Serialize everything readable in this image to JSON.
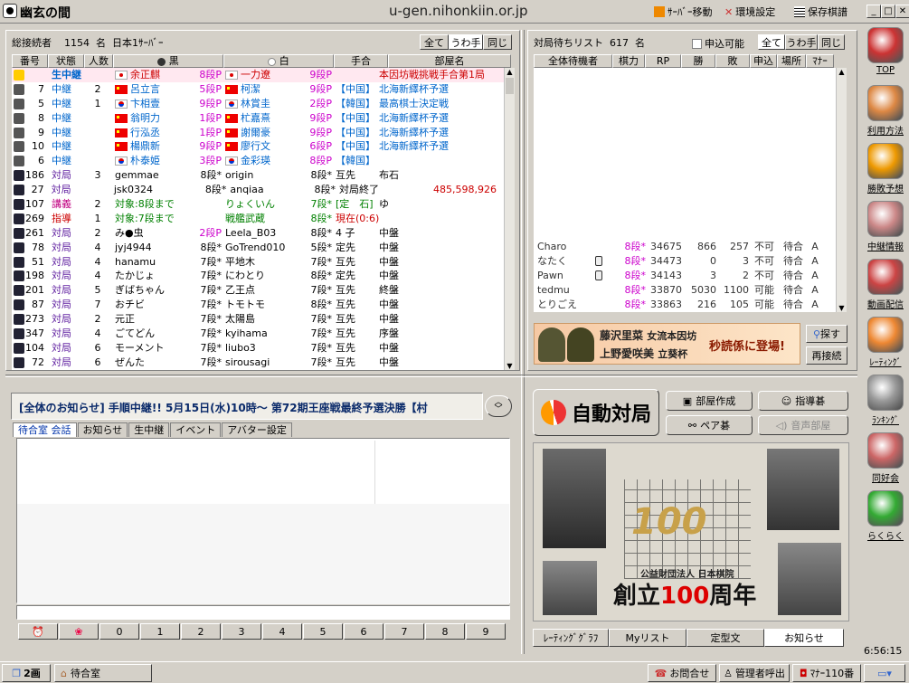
{
  "app": {
    "title": "幽玄の間",
    "url": "u-gen.nihonkiin.or.jp"
  },
  "toolbar": {
    "server_move": "ｻｰﾊﾞｰ移動",
    "env_settings": "環境設定",
    "saved_games": "保存棋譜"
  },
  "left": {
    "connected_label": "総接続者",
    "connected_count": "1154",
    "connected_unit": "名",
    "server": "日本1ｻｰﾊﾞｰ",
    "filters": [
      "全て",
      "うわ手",
      "同じ"
    ],
    "columns": [
      "番号",
      "状態",
      "人数",
      "黒",
      "白",
      "手合",
      "部屋名"
    ],
    "rows": [
      {
        "no": "",
        "status": "生中継",
        "n": "",
        "bf": "jp",
        "black": "余正麒",
        "brank": "8段P",
        "wf": "jp",
        "white": "一力遼",
        "wrank": "9段P",
        "teai": "",
        "room": "本因坊戦挑戦手合第1局"
      },
      {
        "no": "7",
        "status": "中継",
        "n": "2",
        "bf": "cn",
        "black": "呂立言",
        "brank": "5段P",
        "wf": "cn",
        "white": "柯潔",
        "wrank": "9段P",
        "teai": "【中国】",
        "room": "北海新繹杯予選"
      },
      {
        "no": "5",
        "status": "中継",
        "n": "1",
        "bf": "kr",
        "black": "卞相壹",
        "brank": "9段P",
        "wf": "kr",
        "white": "林賞圭",
        "wrank": "2段P",
        "teai": "【韓国】",
        "room": "最高棋士決定戦"
      },
      {
        "no": "8",
        "status": "中継",
        "n": "",
        "bf": "cn",
        "black": "翁明力",
        "brank": "1段P",
        "wf": "cn",
        "white": "杧嘉熹",
        "wrank": "9段P",
        "teai": "【中国】",
        "room": "北海新繹杯予選"
      },
      {
        "no": "9",
        "status": "中継",
        "n": "",
        "bf": "cn",
        "black": "行泓丞",
        "brank": "1段P",
        "wf": "cn",
        "white": "謝爾豪",
        "wrank": "9段P",
        "teai": "【中国】",
        "room": "北海新繹杯予選"
      },
      {
        "no": "10",
        "status": "中継",
        "n": "",
        "bf": "cn",
        "black": "楊鼎新",
        "brank": "9段P",
        "wf": "cn",
        "white": "廖行文",
        "wrank": "6段P",
        "teai": "【中国】",
        "room": "北海新繹杯予選"
      },
      {
        "no": "6",
        "status": "中継",
        "n": "",
        "bf": "kr",
        "black": "朴泰姫",
        "brank": "3段P",
        "wf": "kr",
        "white": "金彩瑛",
        "wrank": "8段P",
        "teai": "【韓国】",
        "room": ""
      },
      {
        "no": "186",
        "status": "対局",
        "n": "3",
        "bf": "",
        "black": "gemmae",
        "brank": "8段*",
        "wf": "",
        "white": "origin",
        "wrank": "8段*",
        "teai": "互先",
        "room": "布石"
      },
      {
        "no": "27",
        "status": "対局",
        "n": "",
        "bf": "",
        "black": "jsk0324",
        "bf2": "kr",
        "brank": "8段*",
        "wf": "",
        "white": "anqiaa",
        "wf2": "cn",
        "wrank": "8段*",
        "teai": "対局終了",
        "room": "485,598,926"
      },
      {
        "no": "107",
        "status": "講義",
        "n": "2",
        "bf": "",
        "black": "対象:8段まで",
        "brank": "",
        "wf": "",
        "white": "りょくいん",
        "wrank": "7段*",
        "teai": "[定　石]",
        "room": "ゆ"
      },
      {
        "no": "269",
        "status": "指導",
        "n": "1",
        "bf": "",
        "black": "対象:7段まで",
        "brank": "",
        "wf": "",
        "white": "戦艦武蔵",
        "wrank": "8段*",
        "teai": "現在(0:6)",
        "room": ""
      },
      {
        "no": "261",
        "status": "対局",
        "n": "2",
        "bf": "",
        "black": "み●虫",
        "brank": "2段P",
        "wf": "",
        "white": "Leela_B03",
        "wrank": "8段*",
        "teai": "4 子",
        "room": "中盤"
      },
      {
        "no": "78",
        "status": "対局",
        "n": "4",
        "bf": "",
        "black": "jyj4944",
        "brank": "8段*",
        "wf": "",
        "white": "GoTrend010",
        "wrank": "5段*",
        "teai": "定先",
        "room": "中盤"
      },
      {
        "no": "51",
        "status": "対局",
        "n": "4",
        "bf": "",
        "black": "hanamu",
        "brank": "7段*",
        "wf": "",
        "white": "平地木",
        "wrank": "7段*",
        "teai": "互先",
        "room": "中盤"
      },
      {
        "no": "198",
        "status": "対局",
        "n": "4",
        "bf": "",
        "black": "たかじょ",
        "brank": "7段*",
        "wf": "",
        "white": "にわとり",
        "wrank": "8段*",
        "teai": "定先",
        "room": "中盤"
      },
      {
        "no": "201",
        "status": "対局",
        "n": "5",
        "bf": "",
        "black": "ぎばちゃん",
        "brank": "7段*",
        "wf": "",
        "white": "乙王点",
        "wrank": "7段*",
        "teai": "互先",
        "room": "終盤"
      },
      {
        "no": "87",
        "status": "対局",
        "n": "7",
        "bf": "",
        "black": "おチビ",
        "brank": "7段*",
        "wf": "",
        "white": "トモトモ",
        "wrank": "8段*",
        "teai": "互先",
        "room": "中盤"
      },
      {
        "no": "273",
        "status": "対局",
        "n": "2",
        "bf": "",
        "black": "元正",
        "brank": "7段*",
        "wf": "",
        "white": "太陽島",
        "wrank": "7段*",
        "teai": "互先",
        "room": "中盤"
      },
      {
        "no": "347",
        "status": "対局",
        "n": "4",
        "bf": "",
        "black": "ごてどん",
        "brank": "7段*",
        "wf": "",
        "white": "kyihama",
        "wrank": "7段*",
        "teai": "互先",
        "room": "序盤"
      },
      {
        "no": "104",
        "status": "対局",
        "n": "6",
        "bf": "",
        "black": "モーメント",
        "brank": "7段*",
        "wf": "",
        "white": "liubo3",
        "wrank": "7段*",
        "teai": "互先",
        "room": "中盤"
      },
      {
        "no": "72",
        "status": "対局",
        "n": "6",
        "bf": "",
        "black": "ぜんた",
        "brank": "7段*",
        "wf": "",
        "white": "sirousagi",
        "wrank": "7段*",
        "teai": "互先",
        "room": "中盤"
      }
    ]
  },
  "right": {
    "waiting_label": "対局待ちリスト",
    "waiting_count": "617",
    "waiting_unit": "名",
    "apply_ok": "申込可能",
    "filters": [
      "全て",
      "うわ手",
      "同じ"
    ],
    "columns": [
      "全体待機者",
      "棋力",
      "RP",
      "勝",
      "敗",
      "申込",
      "場所",
      "ﾏﾅｰ"
    ],
    "rows": [
      {
        "name": "Charo",
        "rank": "8段*",
        "rp": "34675",
        "w": "866",
        "l": "257",
        "apply": "不可",
        "place": "待合",
        "m": "A"
      },
      {
        "name": "なたく",
        "rank": "8段*",
        "rp": "34473",
        "w": "0",
        "l": "3",
        "apply": "不可",
        "place": "待合",
        "m": "A"
      },
      {
        "name": "Pawn",
        "rank": "8段*",
        "rp": "34143",
        "w": "3",
        "l": "2",
        "apply": "不可",
        "place": "待合",
        "m": "A"
      },
      {
        "name": "tedmu",
        "rank": "8段*",
        "rp": "33870",
        "w": "5030",
        "l": "1100",
        "apply": "可能",
        "place": "待合",
        "m": "A"
      },
      {
        "name": "とりごえ",
        "rank": "8段*",
        "rp": "33863",
        "w": "216",
        "l": "105",
        "apply": "可能",
        "place": "待合",
        "m": "A"
      }
    ],
    "banner": {
      "line1a": "藤沢里菜",
      "line1b": "女流本因坊",
      "line2a": "上野愛咲美",
      "line2b": "立葵杯",
      "line3": "秒読係に登場!"
    },
    "search": "探す",
    "reconnect": "再接続",
    "auto_match": "自動対局",
    "create_room": "部屋作成",
    "teaching": "指導碁",
    "pair": "ペア碁",
    "voice_room": "音声部屋",
    "poster": {
      "num": "100",
      "org": "公益財団法人 日本棋院",
      "title": "創立",
      "num2": "100",
      "title2": "周年"
    },
    "bottom_tabs": [
      "ﾚｰﾃｨﾝｸﾞｸﾞﾗﾌ",
      "Myリスト",
      "定型文",
      "お知らせ"
    ]
  },
  "notice": "[全体のお知らせ]  手順中継!!  5月15日(水)10時～  第72期王座戦最終予選決勝【村",
  "chat_tabs": [
    "待合室 会話",
    "お知らせ",
    "生中継",
    "イベント",
    "アバター設定"
  ],
  "keys": [
    "0",
    "1",
    "2",
    "3",
    "4",
    "5",
    "6",
    "7",
    "8",
    "9"
  ],
  "sidebar": [
    "TOP",
    "利用方法",
    "勝敗予想",
    "中継情報",
    "動画配信",
    "ﾚｰﾃｨﾝｸﾞ",
    "ﾗﾝｷﾝｸﾞ",
    "同好会",
    "らくらく"
  ],
  "clock": "6:56:15",
  "taskbar": {
    "screens": "2画",
    "room": "待合室",
    "contact": "お問合せ",
    "admin": "管理者呼出",
    "manners": "ﾏﾅｰ110番"
  },
  "colors": {
    "accent_red": "#cc0000",
    "live_blue": "#0066cc",
    "link_green": "#008000",
    "rank_magenta": "#cc00cc"
  }
}
